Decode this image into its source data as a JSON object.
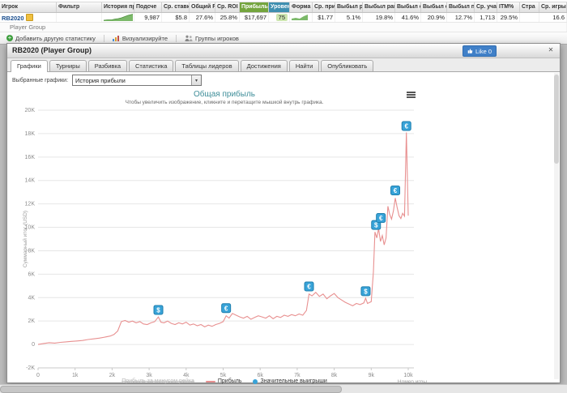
{
  "top_table": {
    "headers": [
      "Игрок",
      "Фильтр",
      "История приб",
      "Подсче",
      "Ср. ставка",
      "Общий ROI",
      "Ср. ROI",
      "Прибыль",
      "Уровень",
      "Форма",
      "Ср. приб",
      "Выбыл рано",
      "Выбыл рано/сре",
      "Выбыл сре",
      "Выбыл сре",
      "Выбыл позд",
      "Ср. уча",
      "ITM%",
      "Стра",
      "Ср. игры"
    ],
    "player": {
      "name": "RB2020",
      "group": "Player Group"
    },
    "values": [
      "9,987",
      "$5.8",
      "27.6%",
      "25.8%",
      "$17,697",
      "75",
      "$1.77",
      "5.1%",
      "19.8%",
      "41.6%",
      "20.9%",
      "12.7%",
      "1,713",
      "29.5%",
      "",
      "16.6"
    ],
    "toolbar": {
      "add_stat": "Добавить другую статистику",
      "visualize": "Визуализируйте",
      "groups": "Группы игроков"
    }
  },
  "panel": {
    "title": "RB2020 (Player Group)",
    "like_button": "Like 0",
    "close": "✕",
    "tabs": [
      "Графики",
      "Турниры",
      "Разбивка",
      "Статистика",
      "Таблицы лидеров",
      "Достижения",
      "Найти",
      "Опубликовать"
    ],
    "graph_select_label": "Выбранные графики:",
    "graph_select_value": "История прибыли"
  },
  "chart_data": {
    "type": "line",
    "title": "Общая прибыль",
    "subtitle": "Чтобы увеличить изображение, кликните и перетащите мышкой внутрь графика.",
    "ylabel": "Суммарный итог (USD)",
    "xlabel": "Номер игры",
    "xmax": 10000,
    "ymin": -2000,
    "ymax": 20000,
    "xtick_step": 1000,
    "ytick_step": 2000,
    "xticks": [
      "0",
      "1k",
      "2k",
      "3k",
      "4k",
      "5k",
      "6k",
      "7k",
      "8k",
      "9k",
      "10k"
    ],
    "yticks": [
      "-2K",
      "0",
      "2K",
      "4K",
      "6K",
      "8K",
      "10K",
      "12K",
      "14K",
      "16K",
      "18K",
      "20K"
    ],
    "line_color": "#e89090",
    "marker_color": "#38a3d8",
    "marker_border": "#1f7fae",
    "legend": [
      {
        "label": "Прибыль за минусом рейка",
        "disabled": true
      },
      {
        "label": "Прибыль",
        "disabled": false
      },
      {
        "label": "Значительные выигрыши",
        "disabled": false
      }
    ],
    "series": [
      [
        0,
        0
      ],
      [
        150,
        80
      ],
      [
        300,
        150
      ],
      [
        450,
        120
      ],
      [
        600,
        180
      ],
      [
        750,
        220
      ],
      [
        900,
        260
      ],
      [
        1050,
        300
      ],
      [
        1200,
        340
      ],
      [
        1350,
        420
      ],
      [
        1500,
        480
      ],
      [
        1650,
        540
      ],
      [
        1800,
        620
      ],
      [
        1950,
        720
      ],
      [
        2050,
        850
      ],
      [
        2150,
        1150
      ],
      [
        2250,
        1950
      ],
      [
        2350,
        2050
      ],
      [
        2450,
        1900
      ],
      [
        2550,
        2000
      ],
      [
        2650,
        1850
      ],
      [
        2750,
        1950
      ],
      [
        2850,
        1750
      ],
      [
        2950,
        1700
      ],
      [
        3050,
        1850
      ],
      [
        3150,
        1950
      ],
      [
        3250,
        2350
      ],
      [
        3320,
        1900
      ],
      [
        3400,
        1850
      ],
      [
        3500,
        2000
      ],
      [
        3600,
        1800
      ],
      [
        3700,
        1700
      ],
      [
        3800,
        1850
      ],
      [
        3900,
        1750
      ],
      [
        4000,
        1900
      ],
      [
        4100,
        1650
      ],
      [
        4200,
        1750
      ],
      [
        4300,
        1600
      ],
      [
        4400,
        1700
      ],
      [
        4500,
        1500
      ],
      [
        4600,
        1650
      ],
      [
        4700,
        1550
      ],
      [
        4800,
        1700
      ],
      [
        4900,
        1800
      ],
      [
        5000,
        1950
      ],
      [
        5080,
        2450
      ],
      [
        5160,
        2250
      ],
      [
        5250,
        2650
      ],
      [
        5350,
        2500
      ],
      [
        5450,
        2350
      ],
      [
        5550,
        2250
      ],
      [
        5650,
        2400
      ],
      [
        5750,
        2150
      ],
      [
        5850,
        2300
      ],
      [
        5950,
        2450
      ],
      [
        6050,
        2350
      ],
      [
        6150,
        2250
      ],
      [
        6250,
        2450
      ],
      [
        6350,
        2200
      ],
      [
        6450,
        2400
      ],
      [
        6550,
        2300
      ],
      [
        6650,
        2500
      ],
      [
        6750,
        2400
      ],
      [
        6850,
        2550
      ],
      [
        6950,
        2450
      ],
      [
        7050,
        2600
      ],
      [
        7150,
        2500
      ],
      [
        7250,
        2900
      ],
      [
        7320,
        4300
      ],
      [
        7400,
        4150
      ],
      [
        7500,
        4450
      ],
      [
        7600,
        4100
      ],
      [
        7700,
        4300
      ],
      [
        7800,
        3900
      ],
      [
        7900,
        4150
      ],
      [
        8000,
        4350
      ],
      [
        8100,
        4000
      ],
      [
        8200,
        3800
      ],
      [
        8300,
        3600
      ],
      [
        8400,
        3450
      ],
      [
        8500,
        3300
      ],
      [
        8600,
        3500
      ],
      [
        8700,
        3400
      ],
      [
        8800,
        3550
      ],
      [
        8850,
        3950
      ],
      [
        8900,
        3500
      ],
      [
        9000,
        3650
      ],
      [
        9060,
        6200
      ],
      [
        9100,
        9600
      ],
      [
        9150,
        9100
      ],
      [
        9200,
        9900
      ],
      [
        9250,
        8800
      ],
      [
        9300,
        9300
      ],
      [
        9350,
        8500
      ],
      [
        9400,
        9100
      ],
      [
        9450,
        11800
      ],
      [
        9500,
        11100
      ],
      [
        9550,
        10700
      ],
      [
        9600,
        11400
      ],
      [
        9650,
        12500
      ],
      [
        9700,
        11700
      ],
      [
        9750,
        11000
      ],
      [
        9800,
        10750
      ],
      [
        9850,
        11200
      ],
      [
        9900,
        10950
      ],
      [
        9950,
        18100
      ],
      [
        10000,
        11000
      ]
    ],
    "markers": [
      {
        "x": 3250,
        "y": 2950,
        "label": "$"
      },
      {
        "x": 5080,
        "y": 3100,
        "label": "€"
      },
      {
        "x": 7320,
        "y": 4950,
        "label": "€"
      },
      {
        "x": 8850,
        "y": 4550,
        "label": "$"
      },
      {
        "x": 9130,
        "y": 10200,
        "label": "$"
      },
      {
        "x": 9260,
        "y": 10800,
        "label": "€"
      },
      {
        "x": 9650,
        "y": 13150,
        "label": "€"
      },
      {
        "x": 9950,
        "y": 18650,
        "label": "€"
      }
    ]
  }
}
